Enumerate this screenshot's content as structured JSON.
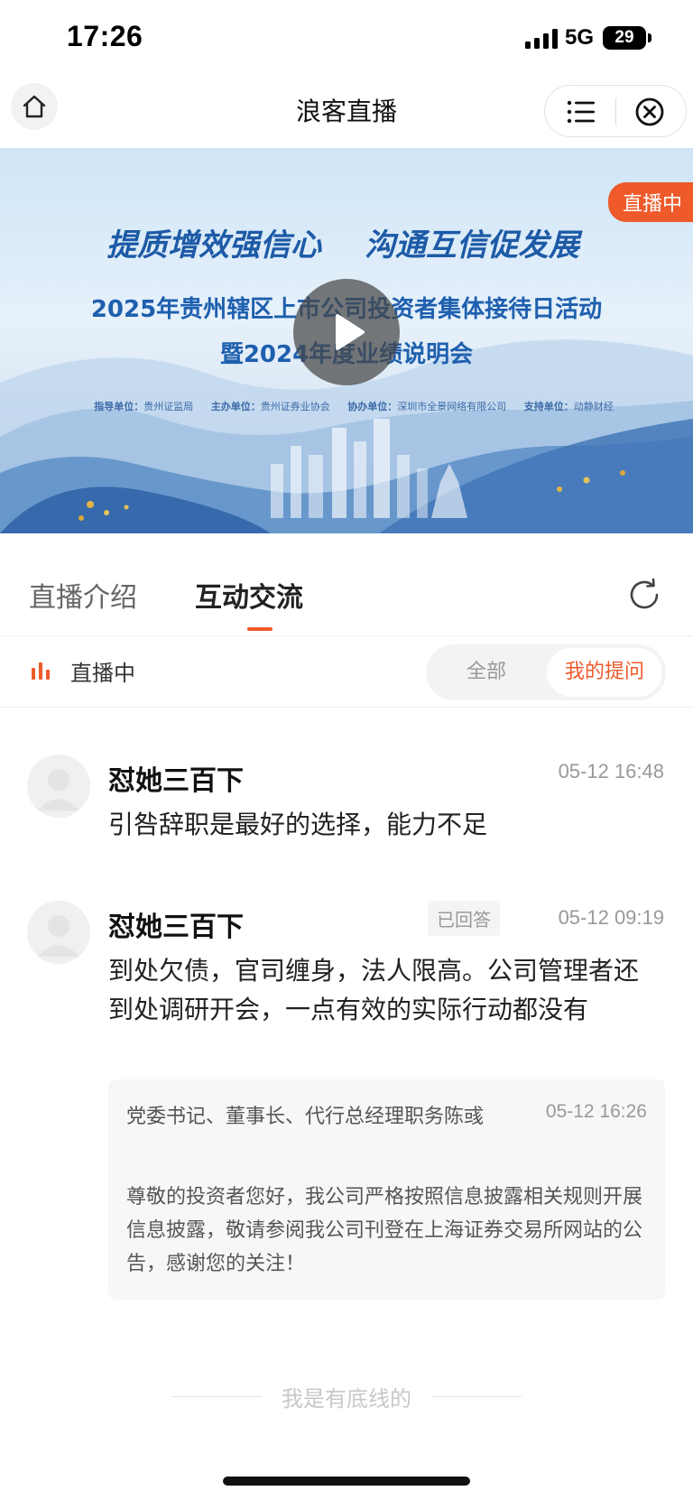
{
  "status_bar": {
    "time": "17:26",
    "network": "5G",
    "battery": "29"
  },
  "nav": {
    "title": "浪客直播"
  },
  "banner": {
    "live_badge": "直播中",
    "slogan_left": "提质增效强信心",
    "slogan_right": "沟通互信促发展",
    "title_line1": "2025年贵州辖区上市公司投资者集体接待日活动",
    "title_line2": "暨2024年度业绩说明会",
    "orgs": [
      {
        "label": "指导单位：",
        "value": "贵州证监局"
      },
      {
        "label": "主办单位：",
        "value": "贵州证券业协会"
      },
      {
        "label": "协办单位：",
        "value": "深圳市全景网络有限公司"
      },
      {
        "label": "支持单位：",
        "value": "动静财经"
      }
    ]
  },
  "tabs": [
    {
      "label": "直播介绍",
      "active": false
    },
    {
      "label": "互动交流",
      "active": true
    }
  ],
  "filter": {
    "status": "直播中",
    "options": [
      {
        "label": "全部",
        "selected": false
      },
      {
        "label": "我的提问",
        "selected": true
      }
    ]
  },
  "comments": [
    {
      "user": "怼她三百下",
      "time": "05-12 16:48",
      "text": "引咎辞职是最好的选择，能力不足"
    },
    {
      "user": "怼她三百下",
      "status": "已回答",
      "time": "05-12 09:19",
      "text": "到处欠债，官司缠身，法人限高。公司管理者还到处调研开会，一点有效的实际行动都没有",
      "reply": {
        "author": "党委书记、董事长、代行总经理职务陈彧",
        "time": "05-12 16:26",
        "text": "尊敬的投资者您好，我公司严格按照信息披露相关规则开展信息披露，敬请参阅我公司刊登在上海证券交易所网站的公告，感谢您的关注！"
      }
    }
  ],
  "footer": {
    "end_text": "我是有底线的"
  },
  "colors": {
    "accent": "#ee5a2a",
    "banner_blue": "#1e5fae"
  }
}
